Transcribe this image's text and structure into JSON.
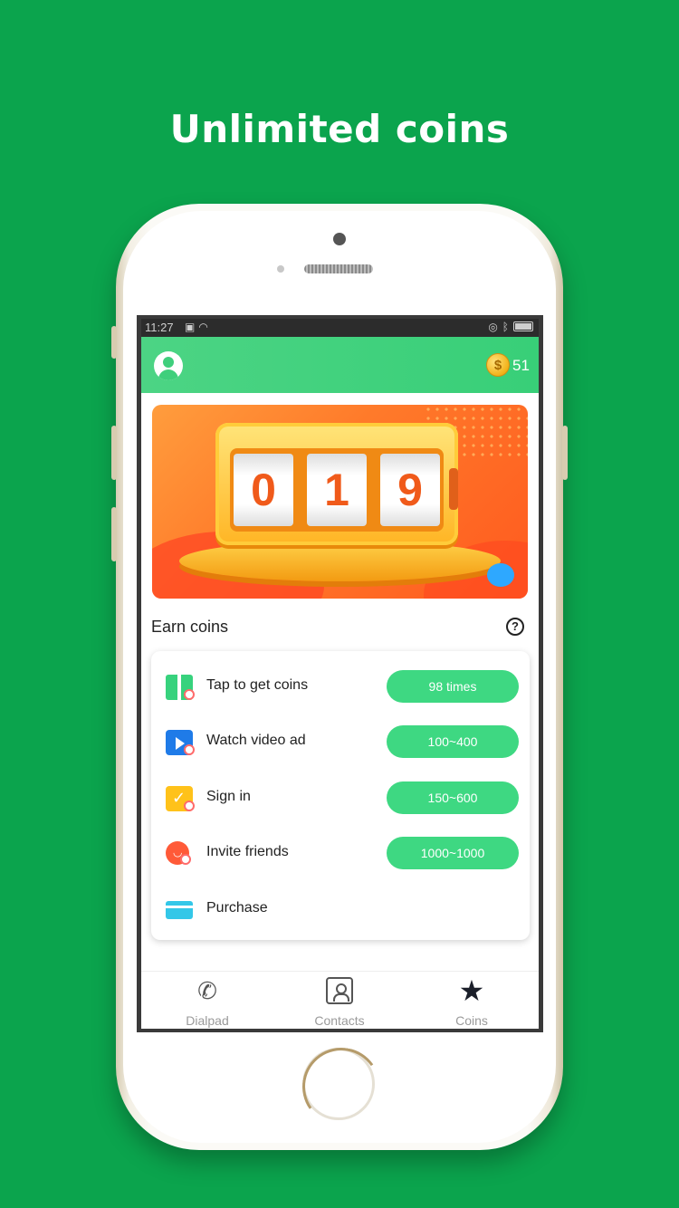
{
  "headline": "Unlimited coins",
  "status_bar": {
    "time": "11:27",
    "left_icons": [
      "sim-x-icon",
      "wifi-icon"
    ],
    "right_icons": [
      "alarm-icon",
      "bluetooth-icon",
      "battery-icon"
    ]
  },
  "app_bar": {
    "coin_balance": "51",
    "coin_symbol": "$"
  },
  "banner": {
    "digits": [
      "0",
      "1",
      "9"
    ]
  },
  "earn_section": {
    "title": "Earn coins",
    "help_symbol": "?"
  },
  "tasks": [
    {
      "label": "Tap to get coins",
      "reward": "98 times",
      "icon": "gift-icon"
    },
    {
      "label": "Watch video ad",
      "reward": "100~400",
      "icon": "video-icon"
    },
    {
      "label": "Sign in",
      "reward": "150~600",
      "icon": "calendar-check-icon"
    },
    {
      "label": "Invite friends",
      "reward": "1000~1000",
      "icon": "friend-icon"
    },
    {
      "label": "Purchase",
      "reward": "",
      "icon": "card-icon"
    }
  ],
  "tab_bar": {
    "tabs": [
      {
        "label": "Dialpad",
        "icon": "phone-icon",
        "active": false
      },
      {
        "label": "Contacts",
        "icon": "contacts-icon",
        "active": false
      },
      {
        "label": "Coins",
        "icon": "star-icon",
        "active": true
      }
    ]
  },
  "colors": {
    "background": "#0ba44d",
    "app_bar": "#3fd07c",
    "pill": "#3ed882",
    "banner": "#ff7a2a"
  }
}
